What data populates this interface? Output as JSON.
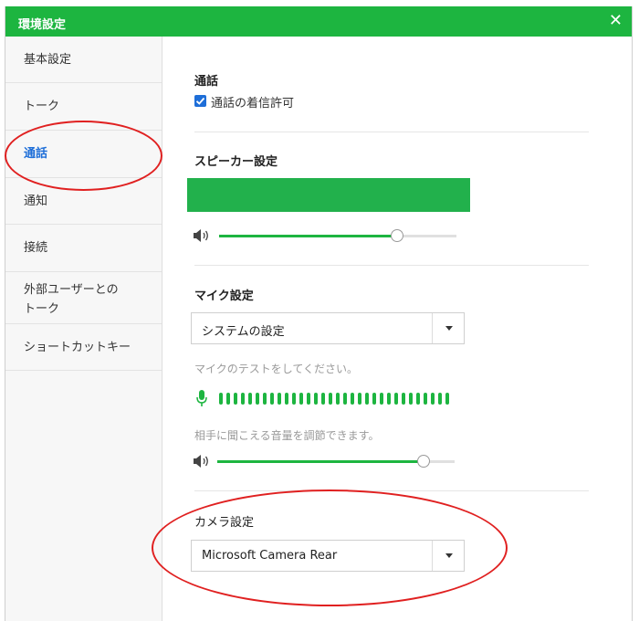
{
  "window": {
    "title": "環境設定"
  },
  "sidebar": {
    "items": [
      {
        "label": "基本設定"
      },
      {
        "label": "トーク"
      },
      {
        "label": "通話"
      },
      {
        "label": "通知"
      },
      {
        "label": "接続"
      },
      {
        "label_line1": "外部ユーザーとの",
        "label_line2": "トーク"
      },
      {
        "label": "ショートカットキー"
      }
    ],
    "active": "通話"
  },
  "call": {
    "title": "通話",
    "allow_incoming_label": "通話の着信許可",
    "allow_incoming_checked": true
  },
  "speaker": {
    "title": "スピーカー設定",
    "volume_percent": 75
  },
  "mic": {
    "title": "マイク設定",
    "device": "システムの設定",
    "test_hint": "マイクのテストをしてください。",
    "level_bars": 32,
    "volume_hint": "相手に聞こえる音量を調節できます。",
    "volume_percent": 87
  },
  "camera": {
    "title": "カメラ設定",
    "device": "Microsoft Camera Rear"
  },
  "colors": {
    "titlebar": "#1db540",
    "active_nav": "#1e6ed8",
    "meter": "#1db540",
    "annotation": "#e02020"
  }
}
